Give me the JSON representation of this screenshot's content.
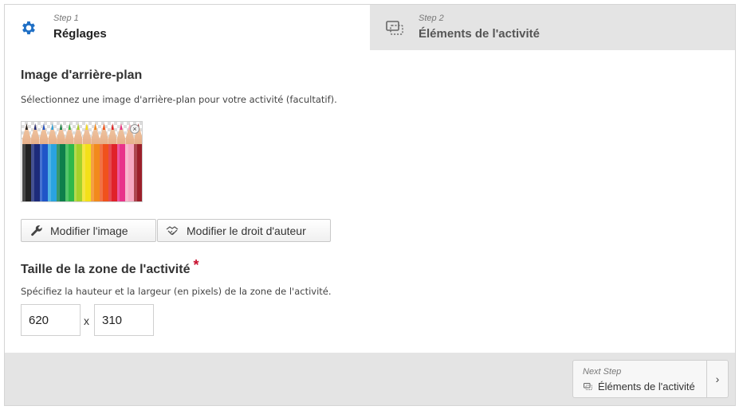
{
  "steps": [
    {
      "step_label": "Step 1",
      "title": "Réglages",
      "active": true,
      "icon": "gear-icon"
    },
    {
      "step_label": "Step 2",
      "title": "Éléments de l'activité",
      "active": false,
      "icon": "slides-icon"
    }
  ],
  "background": {
    "heading": "Image d'arrière-plan",
    "description": "Sélectionnez une image d'arrière-plan pour votre activité (facultatif).",
    "thumbnail_icon": "colored-pencils-image",
    "pencil_colors": [
      "#222222",
      "#1d2b7a",
      "#1f55c8",
      "#2aa3e0",
      "#0e7f4b",
      "#2fb84a",
      "#a6d12a",
      "#f3e019",
      "#f28a1c",
      "#f0521c",
      "#e0222a",
      "#e8338a",
      "#f7a8c2",
      "#9b1f2a"
    ],
    "remove_symbol": "×",
    "edit_image_label": "Modifier l'image",
    "edit_copyright_label": "Modifier le droit d'auteur"
  },
  "size": {
    "heading": "Taille de la zone de l'activité",
    "required_marker": "*",
    "description": "Spécifiez la hauteur et la largeur (en pixels) de la zone de l'activité.",
    "height_value": "620",
    "separator": "x",
    "width_value": "310"
  },
  "footer": {
    "next_label": "Next Step",
    "next_title": "Éléments de l'activité",
    "arrow": "›"
  },
  "colors": {
    "accent": "#1f6fc5",
    "tab_inactive_bg": "#e4e4e4",
    "required": "#c8102e"
  }
}
